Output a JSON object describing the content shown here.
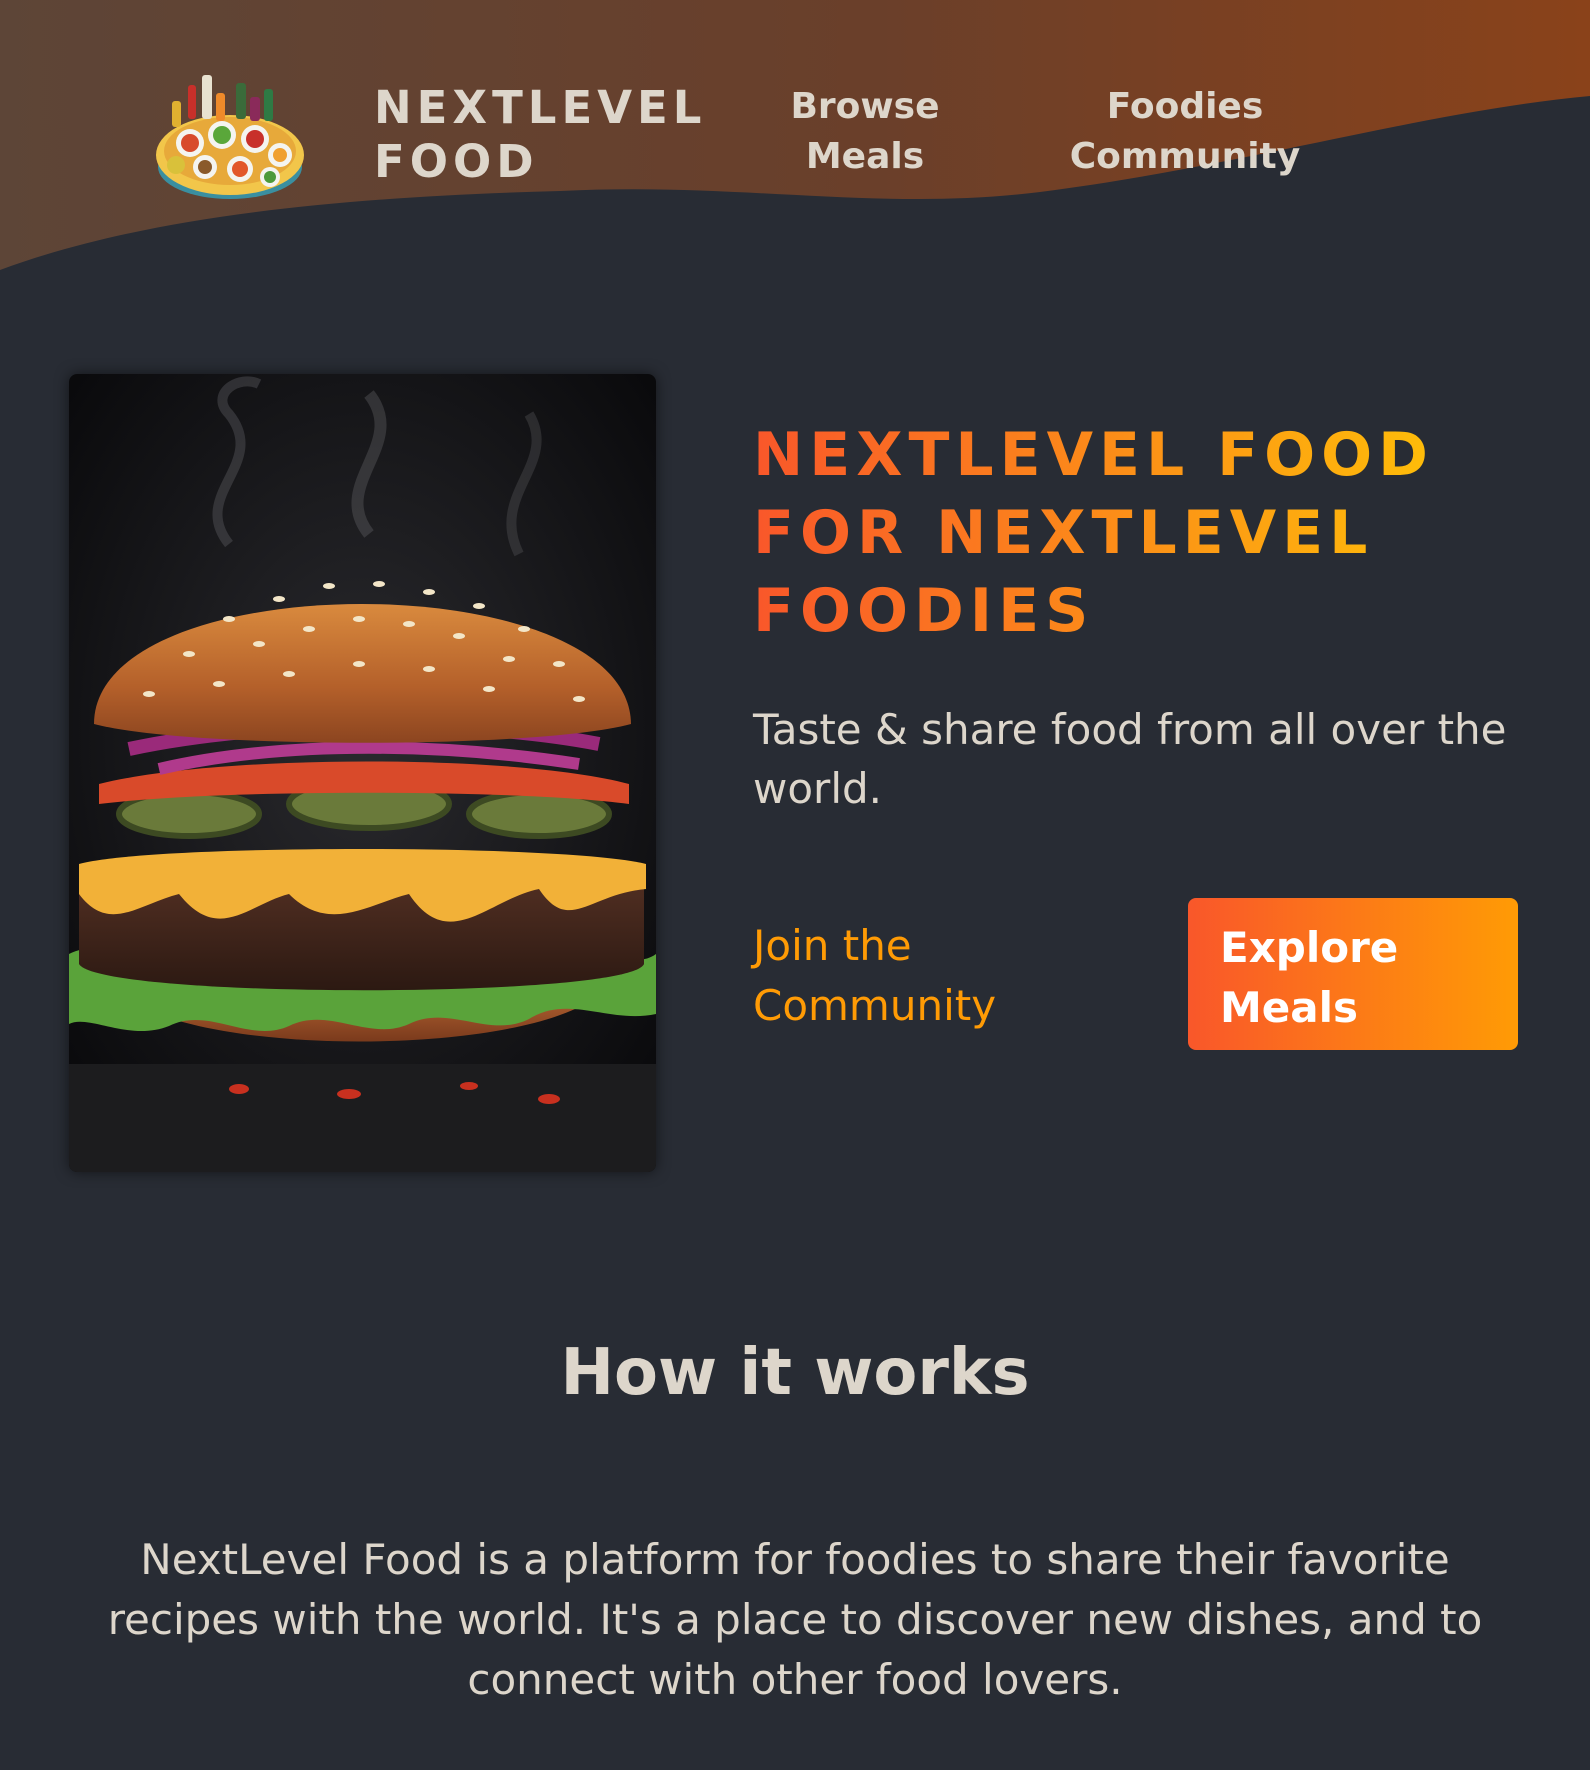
{
  "header": {
    "logo_text": "NEXTLEVEL FOOD",
    "logo_icon": "food-platter-icon",
    "nav": {
      "browse_meals": "Browse Meals",
      "foodies_community": "Foodies Community"
    },
    "gradient_colors": [
      "#5d4537",
      "#8a421a"
    ]
  },
  "hero": {
    "image_subject": "burger",
    "title": "NEXTLEVEL FOOD FOR NEXTLEVEL FOODIES",
    "subtitle": "Taste & share food from all over the world.",
    "cta_join": "Join the Community",
    "cta_explore": "Explore Meals",
    "title_gradient": [
      "#f9572a",
      "#ffc905"
    ],
    "button_gradient": [
      "#f9572a",
      "#ff9b05"
    ]
  },
  "how_it_works": {
    "title": "How it works",
    "text": "NextLevel Food is a platform for foodies to share their favorite recipes with the world. It's a place to discover new dishes, and to connect with other food lovers."
  },
  "colors": {
    "background": "#282c34",
    "text": "#ddd6cb",
    "accent": "#ff9b05"
  }
}
